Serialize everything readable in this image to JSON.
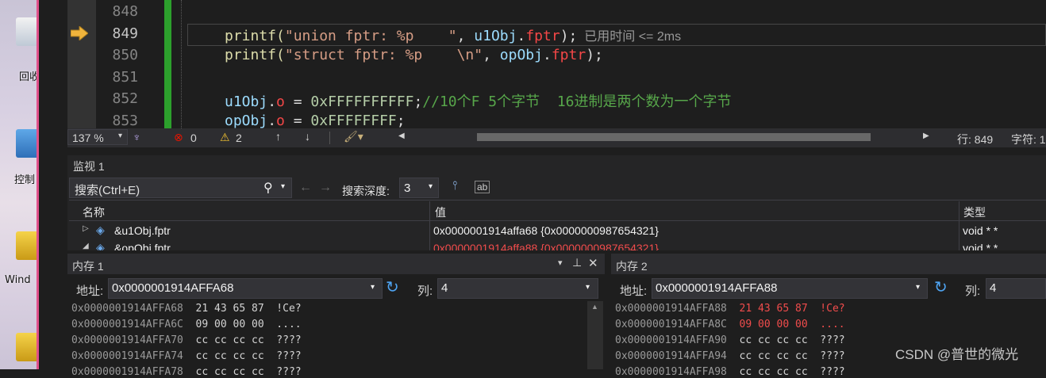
{
  "desktop": {
    "labels": [
      "回收",
      "控制",
      "Wind"
    ]
  },
  "editor": {
    "lines": [
      {
        "num": "848",
        "parts": []
      },
      {
        "num": "849",
        "parts": [
          {
            "t": "printf(",
            "c": "k-fn"
          },
          {
            "t": "\"union fptr: %p    \"",
            "c": "k-str"
          },
          {
            "t": ", ",
            "c": ""
          },
          {
            "t": "u1Obj",
            "c": "k-var"
          },
          {
            "t": ".",
            "c": ""
          },
          {
            "t": "fptr",
            "c": "k-mem"
          },
          {
            "t": ");",
            "c": ""
          }
        ],
        "hint": "已用时间 <= 2ms"
      },
      {
        "num": "850",
        "parts": [
          {
            "t": "printf(",
            "c": "k-fn"
          },
          {
            "t": "\"struct fptr: %p    \\n\"",
            "c": "k-str"
          },
          {
            "t": ", ",
            "c": ""
          },
          {
            "t": "opObj",
            "c": "k-var"
          },
          {
            "t": ".",
            "c": ""
          },
          {
            "t": "fptr",
            "c": "k-mem"
          },
          {
            "t": ");",
            "c": ""
          }
        ]
      },
      {
        "num": "851",
        "parts": []
      },
      {
        "num": "852",
        "parts": [
          {
            "t": "u1Obj",
            "c": "k-var"
          },
          {
            "t": ".",
            "c": ""
          },
          {
            "t": "o",
            "c": "k-mem"
          },
          {
            "t": " = ",
            "c": ""
          },
          {
            "t": "0xFFFFFFFFFF",
            "c": "k-num"
          },
          {
            "t": ";",
            "c": ""
          },
          {
            "t": "//10个F 5个字节  16进制是两个数为一个字节",
            "c": "k-cmt"
          }
        ]
      },
      {
        "num": "853",
        "parts": [
          {
            "t": "opObj",
            "c": "k-var"
          },
          {
            "t": ".",
            "c": ""
          },
          {
            "t": "o",
            "c": "k-mem"
          },
          {
            "t": " = ",
            "c": ""
          },
          {
            "t": "0xFFFFFFFF",
            "c": "k-num"
          },
          {
            "t": ";",
            "c": ""
          }
        ]
      }
    ],
    "status": {
      "zoom": "137 %",
      "errors": "0",
      "warnings": "2",
      "line": "行: 849",
      "col": "字符: 1"
    }
  },
  "watch": {
    "title": "监视 1",
    "search_placeholder": "搜索(Ctrl+E)",
    "depth_label": "搜索深度:",
    "depth_value": "3",
    "col_name": "名称",
    "col_value": "值",
    "col_type": "类型",
    "rows": [
      {
        "name": "&u1Obj.fptr",
        "value": "0x0000001914affa68 {0x0000000987654321}",
        "type": "void * *"
      },
      {
        "name": "&opObj.fptr",
        "value": "0x0000001914affa88 {0x0000000987654321}",
        "type": "void * *"
      }
    ]
  },
  "memory1": {
    "title": "内存 1",
    "addr_label": "地址:",
    "address": "0x0000001914AFFA68",
    "cols_label": "列:",
    "cols": "4",
    "rows": [
      {
        "addr": "0x0000001914AFFA68",
        "bytes": "21 43 65 87",
        "ascii": "!Ce?",
        "changed": false
      },
      {
        "addr": "0x0000001914AFFA6C",
        "bytes": "09 00 00 00",
        "ascii": "....",
        "changed": false
      },
      {
        "addr": "0x0000001914AFFA70",
        "bytes": "cc cc cc cc",
        "ascii": "????",
        "changed": false
      },
      {
        "addr": "0x0000001914AFFA74",
        "bytes": "cc cc cc cc",
        "ascii": "????",
        "changed": false
      },
      {
        "addr": "0x0000001914AFFA78",
        "bytes": "cc cc cc cc",
        "ascii": "????",
        "changed": false
      }
    ]
  },
  "memory2": {
    "title": "内存 2",
    "addr_label": "地址:",
    "address": "0x0000001914AFFA88",
    "cols_label": "列:",
    "cols": "4",
    "rows": [
      {
        "addr": "0x0000001914AFFA88",
        "bytes": "21 43 65 87",
        "ascii": "!Ce?",
        "changed": true
      },
      {
        "addr": "0x0000001914AFFA8C",
        "bytes": "09 00 00 00",
        "ascii": "....",
        "changed": true
      },
      {
        "addr": "0x0000001914AFFA90",
        "bytes": "cc cc cc cc",
        "ascii": "????",
        "changed": false
      },
      {
        "addr": "0x0000001914AFFA94",
        "bytes": "cc cc cc cc",
        "ascii": "????",
        "changed": false
      },
      {
        "addr": "0x0000001914AFFA98",
        "bytes": "cc cc cc cc",
        "ascii": "????",
        "changed": false
      }
    ]
  },
  "watermark": "CSDN @普世的微光"
}
